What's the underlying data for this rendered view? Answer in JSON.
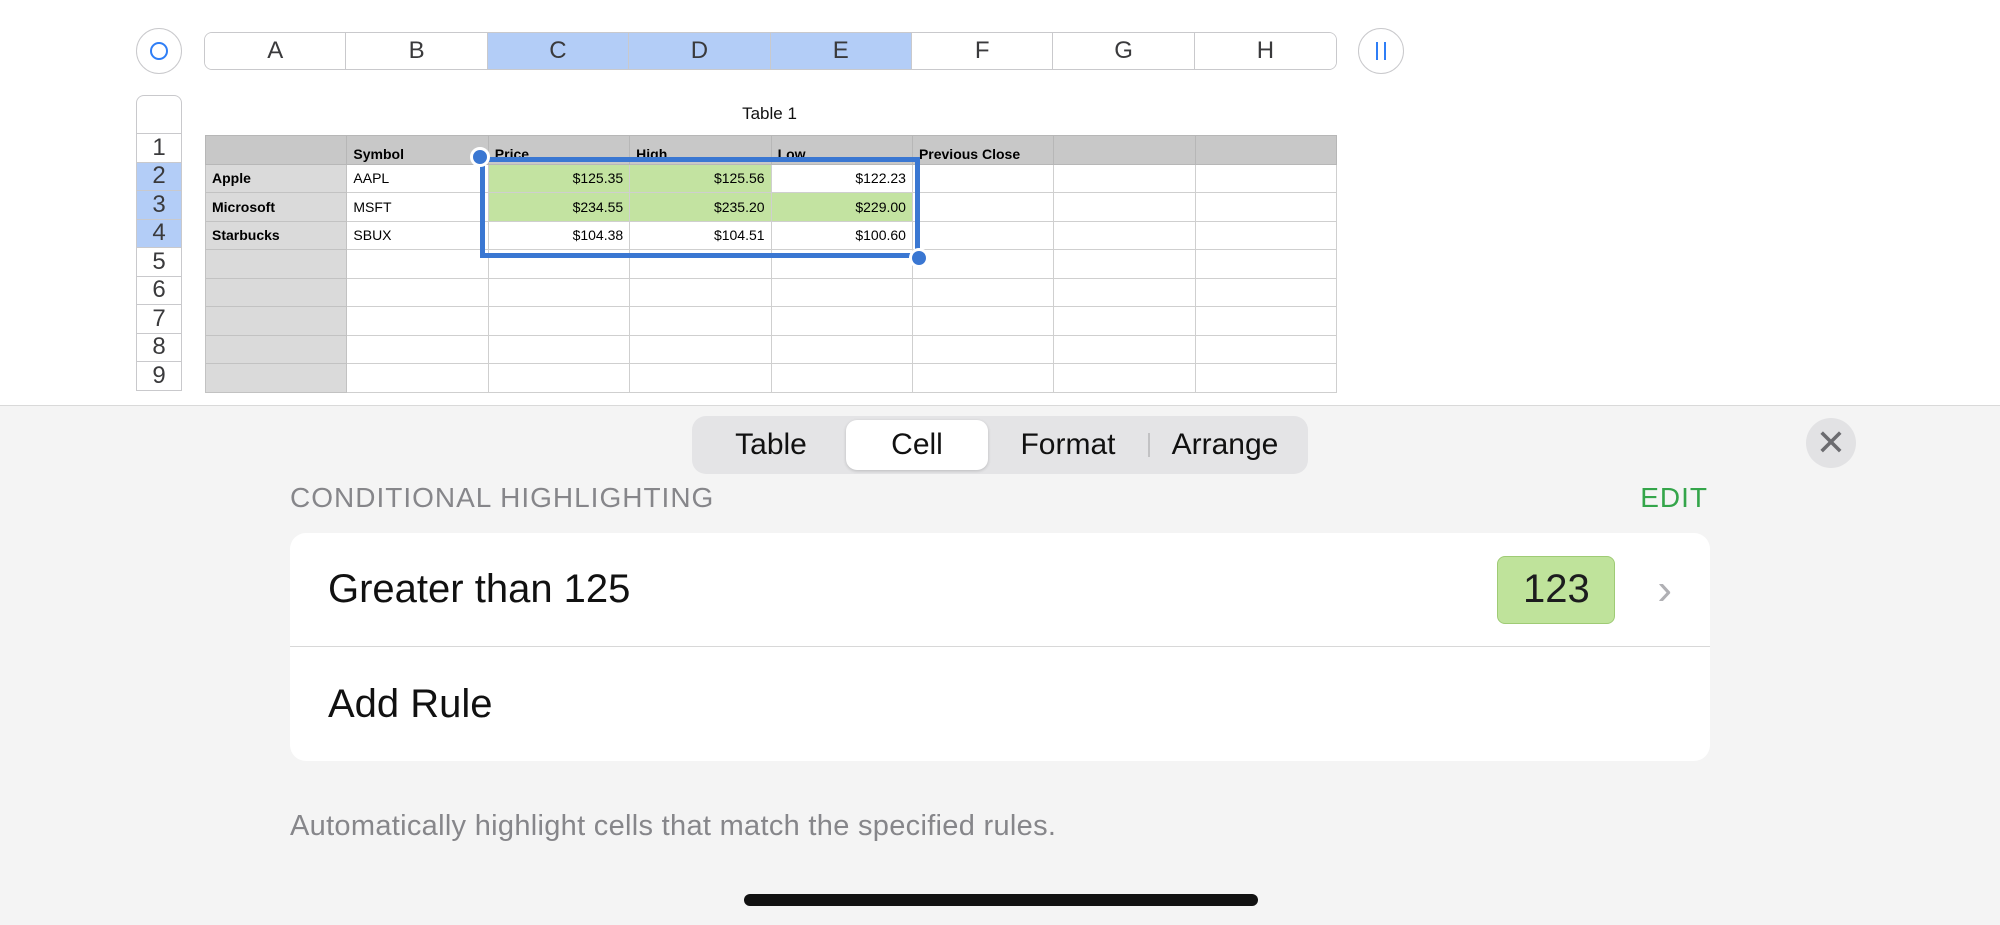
{
  "sheet": {
    "table_title": "Table 1",
    "column_headers": [
      "A",
      "B",
      "C",
      "D",
      "E",
      "F",
      "G",
      "H"
    ],
    "row_headers": [
      "1",
      "2",
      "3",
      "4",
      "5",
      "6",
      "7",
      "8",
      "9"
    ],
    "header_row": [
      "",
      "Symbol",
      "Price",
      "High",
      "Low",
      "Previous Close",
      "",
      ""
    ],
    "rows": [
      [
        "Apple",
        "AAPL",
        "$125.35",
        "$125.56",
        "$122.23",
        "",
        "",
        ""
      ],
      [
        "Microsoft",
        "MSFT",
        "$234.55",
        "$235.20",
        "$229.00",
        "",
        "",
        ""
      ],
      [
        "Starbucks",
        "SBUX",
        "$104.38",
        "$104.51",
        "$100.60",
        "",
        "",
        ""
      ],
      [
        "",
        "",
        "",
        "",
        "",
        "",
        "",
        ""
      ],
      [
        "",
        "",
        "",
        "",
        "",
        "",
        "",
        ""
      ],
      [
        "",
        "",
        "",
        "",
        "",
        "",
        "",
        ""
      ],
      [
        "",
        "",
        "",
        "",
        "",
        "",
        "",
        ""
      ],
      [
        "",
        "",
        "",
        "",
        "",
        "",
        "",
        ""
      ]
    ],
    "highlight_color": "#c3e3a1",
    "selection_color": "#3a77d2"
  },
  "inspector": {
    "tabs": [
      "Table",
      "Cell",
      "Format",
      "Arrange"
    ],
    "active_tab": "Cell",
    "section_title": "CONDITIONAL HIGHLIGHTING",
    "edit_label": "EDIT",
    "rules": [
      {
        "label": "Greater than 125",
        "preview": "123"
      }
    ],
    "add_rule_label": "Add Rule",
    "footer": "Automatically highlight cells that match the specified rules.",
    "close_icon": "close-icon",
    "accent_green": "#34a54a"
  }
}
